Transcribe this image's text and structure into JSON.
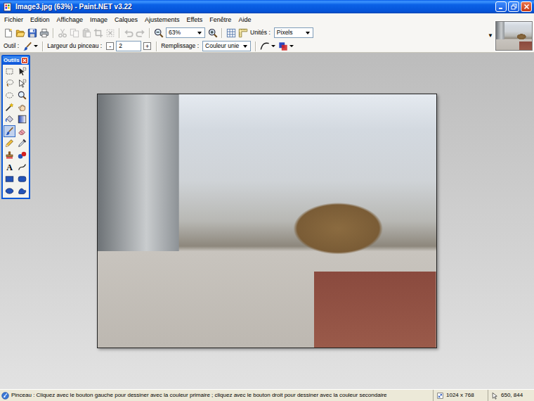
{
  "window": {
    "title": "Image3.jpg (63%) - Paint.NET v3.22"
  },
  "menu": [
    "Fichier",
    "Edition",
    "Affichage",
    "Image",
    "Calques",
    "Ajustements",
    "Effets",
    "Fenêtre",
    "Aide"
  ],
  "toolbar": {
    "items": [
      {
        "kind": "new",
        "disabled": false
      },
      {
        "kind": "open",
        "disabled": false
      },
      {
        "kind": "save",
        "disabled": false
      },
      {
        "kind": "print",
        "disabled": false
      },
      {
        "kind": "separator"
      },
      {
        "kind": "cut",
        "disabled": true
      },
      {
        "kind": "copy",
        "disabled": true
      },
      {
        "kind": "paste",
        "disabled": true
      },
      {
        "kind": "crop",
        "disabled": true
      },
      {
        "kind": "deselect",
        "disabled": true
      },
      {
        "kind": "separator"
      },
      {
        "kind": "undo",
        "disabled": true
      },
      {
        "kind": "redo",
        "disabled": true
      },
      {
        "kind": "separator"
      },
      {
        "kind": "zoomout",
        "disabled": false
      },
      {
        "kind": "dropdown",
        "value": "63%"
      },
      {
        "kind": "zoomin",
        "disabled": false
      },
      {
        "kind": "separator"
      },
      {
        "kind": "grid",
        "disabled": false
      },
      {
        "kind": "ruler",
        "disabled": false
      },
      {
        "kind": "label",
        "text": "Unités :"
      },
      {
        "kind": "dropdown",
        "value": "Pixels"
      }
    ]
  },
  "tool_options": {
    "items": [
      {
        "kind": "label",
        "text": "Outil :"
      },
      {
        "kind": "brush",
        "disabled": false
      },
      {
        "kind": "separator"
      },
      {
        "kind": "label",
        "text": "Largeur du pinceau :"
      },
      {
        "kind": "stepper",
        "text": "-"
      },
      {
        "kind": "field",
        "value": "2"
      },
      {
        "kind": "stepper",
        "text": "+"
      },
      {
        "kind": "separator"
      },
      {
        "kind": "label",
        "text": "Remplissage :"
      },
      {
        "kind": "dropdown",
        "value": "Couleur unie"
      },
      {
        "kind": "separator"
      },
      {
        "kind": "antialias",
        "disabled": false
      },
      {
        "kind": "blend",
        "disabled": false
      }
    ]
  },
  "image_list": {
    "arrow": "▼"
  },
  "tools_window": {
    "title": "Outils",
    "tools": [
      {
        "kind": "rectselect",
        "selected": false
      },
      {
        "kind": "movepixels",
        "selected": false
      },
      {
        "kind": "lasso",
        "selected": false
      },
      {
        "kind": "moveselection",
        "selected": false
      },
      {
        "kind": "ellipseselect",
        "selected": false
      },
      {
        "kind": "zoom",
        "selected": false
      },
      {
        "kind": "magicwand",
        "selected": false
      },
      {
        "kind": "pan",
        "selected": false
      },
      {
        "kind": "bucket",
        "selected": false
      },
      {
        "kind": "gradient",
        "selected": false
      },
      {
        "kind": "paintbrush",
        "selected": true
      },
      {
        "kind": "eraser",
        "selected": false
      },
      {
        "kind": "pencil",
        "selected": false
      },
      {
        "kind": "colorpicker",
        "selected": false
      },
      {
        "kind": "clonestamp",
        "selected": false
      },
      {
        "kind": "recolor",
        "selected": false
      },
      {
        "kind": "text",
        "glyph": "A",
        "selected": false
      },
      {
        "kind": "linecurve",
        "selected": false
      },
      {
        "kind": "rectangle",
        "selected": false
      },
      {
        "kind": "roundrect",
        "selected": false
      },
      {
        "kind": "ellipse",
        "selected": false
      },
      {
        "kind": "freeform",
        "selected": false
      }
    ]
  },
  "status_bar": {
    "hint": "Pinceau : Cliquez avec le bouton gauche pour dessiner avec la couleur primaire ; cliquez avec le bouton droit pour dessiner avec la couleur secondaire",
    "size": "1024 x 768",
    "cursor": "650, 844"
  }
}
